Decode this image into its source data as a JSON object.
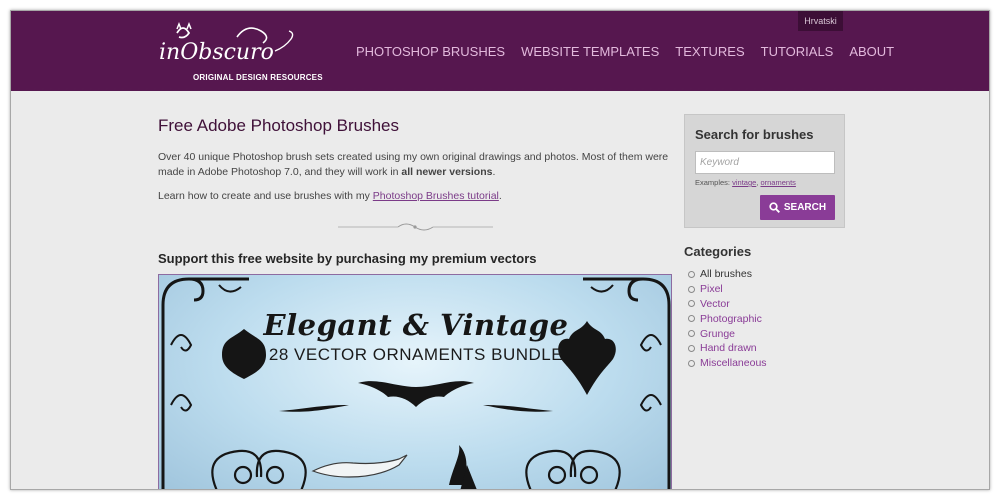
{
  "header": {
    "language_link": "Hrvatski",
    "logo_text": "inObscuro",
    "logo_tagline": "ORIGINAL DESIGN RESOURCES",
    "nav": [
      "PHOTOSHOP BRUSHES",
      "WEBSITE TEMPLATES",
      "TEXTURES",
      "TUTORIALS",
      "ABOUT"
    ]
  },
  "main": {
    "title": "Free Adobe Photoshop Brushes",
    "intro_before": "Over 40 unique Photoshop brush sets created using my own original drawings and photos. Most of them were made in Adobe Photoshop 7.0, and they will work in ",
    "intro_bold": "all newer versions",
    "intro_after": ".",
    "learn_before": "Learn how to create and use brushes with my ",
    "learn_link": "Photoshop Brushes tutorial",
    "learn_after": ".",
    "support_heading": "Support this free website by purchasing my premium vectors",
    "banner_title": "Elegant & Vintage",
    "banner_subtitle": "28 VECTOR ORNAMENTS BUNDLE"
  },
  "sidebar": {
    "search_title": "Search for brushes",
    "search_placeholder": "Keyword",
    "examples_label": "Examples: ",
    "example_links": [
      "vintage",
      "ornaments"
    ],
    "search_button": "SEARCH",
    "categories_title": "Categories",
    "categories": [
      "All brushes",
      "Pixel",
      "Vector",
      "Photographic",
      "Grunge",
      "Hand drawn",
      "Miscellaneous"
    ]
  },
  "colors": {
    "header_bg": "#56174f",
    "nav_link": "#e2b9dc",
    "accent": "#8a3c97"
  },
  "icons": [
    "search-icon",
    "category-bullet-icon"
  ]
}
